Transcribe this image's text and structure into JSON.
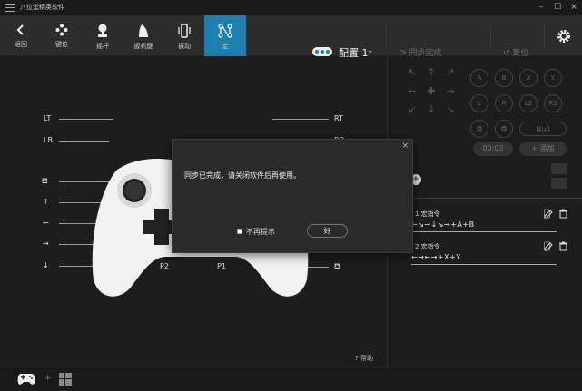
{
  "window": {
    "title": "八位堂精英软件"
  },
  "toolbar": {
    "items": [
      {
        "label": "返回",
        "icon": "back-arrow-icon"
      },
      {
        "label": "键位",
        "icon": "dpad-buttons-icon"
      },
      {
        "label": "摇杆",
        "icon": "joystick-icon"
      },
      {
        "label": "扳机键",
        "icon": "trigger-icon"
      },
      {
        "label": "振动",
        "icon": "vibration-icon"
      },
      {
        "label": "宏",
        "icon": "macro-icon"
      }
    ],
    "active": "宏",
    "config_label": "配置 1",
    "sync_label": "同步完成",
    "reset_label": "复位"
  },
  "controller_labels": {
    "lt": "LT",
    "lb": "LB",
    "rt": "RT",
    "rb": "RB",
    "p2": "P2",
    "p1": "P1"
  },
  "right_panel": {
    "face_buttons": [
      "A",
      "B",
      "X",
      "Y",
      "L",
      "R",
      "L2",
      "R2"
    ],
    "null_label": "Null",
    "timer": "00:03",
    "add_label": "+ 添加",
    "macros": [
      {
        "title": "1 宏指令",
        "sequence": "←↘→↓↘→+A+B"
      },
      {
        "title": "2 宏指令",
        "sequence": "←→←→+X+Y"
      }
    ]
  },
  "dialog": {
    "message": "同步已完成，请关闭软件后再使用。",
    "checkbox_label": "不再提示",
    "ok_label": "好",
    "close": "×"
  },
  "help_label": "帮助",
  "bottom": {
    "plus": "+"
  },
  "colors": {
    "accent": "#1c7faf",
    "dark_bg": "#1d1d1d",
    "toolbar_bg": "#2c2c2c"
  }
}
